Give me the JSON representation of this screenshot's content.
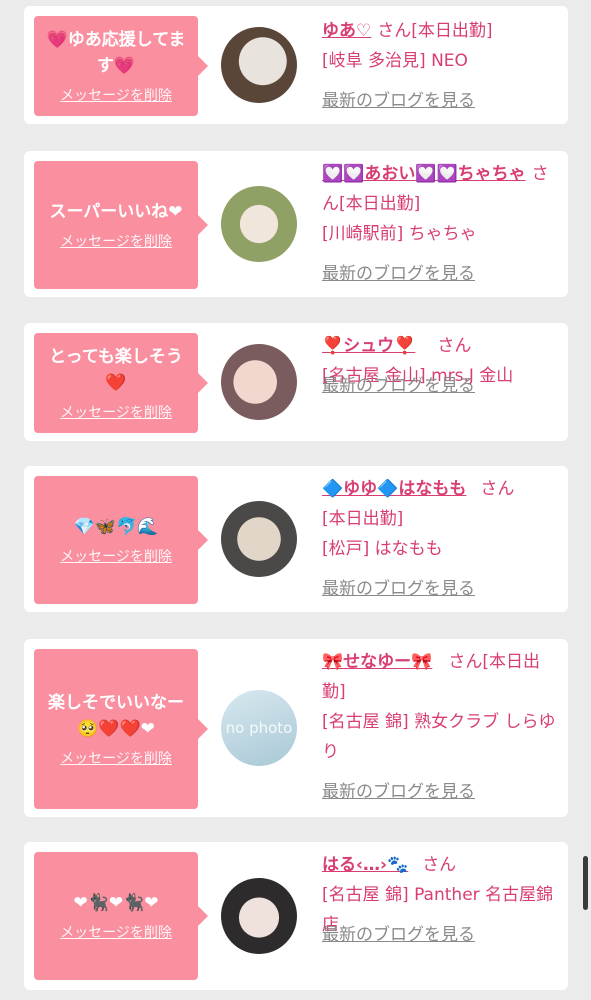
{
  "entries": [
    {
      "message": "💗ゆあ応援してます💗",
      "delete_label": "メッセージを削除",
      "name": "ゆあ♡",
      "suffix": "さん",
      "line1": "[本日出勤]",
      "line2": "[岐阜 多治見] NEO",
      "blog_label": "最新のブログを見る",
      "avatar_colors": [
        "#d9d4cf",
        "#3b2d25"
      ]
    },
    {
      "message": "スーパーいいね❤",
      "delete_label": "メッセージを削除",
      "name": "💟💟あおい💟💟ちゃちゃ",
      "suffix": "さん",
      "line1": "[本日出勤]",
      "line2": "[川崎駅前] ちゃちゃ",
      "blog_label": "最新のブログを見る",
      "avatar_colors": [
        "#a8b47a",
        "#e7ddd0"
      ]
    },
    {
      "message": "とっても楽しそう❤️",
      "delete_label": "メッセージを削除",
      "name": "❣️シュウ❣️",
      "suffix": "さん",
      "line1": "[名古屋 金山] mrs.J 金山",
      "line2": "",
      "blog_label": "最新のブログを見る",
      "avatar_colors": [
        "#8d6d6f",
        "#e9c9c4"
      ]
    },
    {
      "message": "💎🦋🐬🌊",
      "delete_label": "メッセージを削除",
      "name": "🔷ゆゆ🔷はなもも",
      "suffix": "さん",
      "line1": "[本日出勤]",
      "line2": "[松戸] はなもも",
      "blog_label": "最新のブログを見る",
      "avatar_colors": [
        "#5c5a58",
        "#d9d0c4"
      ]
    },
    {
      "message": "楽しそでいいなー🥺❤️❤️❤",
      "delete_label": "メッセージを削除",
      "name": "🎀せなゆー🎀",
      "suffix": "さん",
      "line1": "[本日出勤]",
      "line2": "[名古屋 錦] 熟女クラブ しらゆり",
      "blog_label": "最新のブログを見る",
      "avatar_text": "no photo",
      "avatar_colors": [
        "#bcd7e2",
        "#dbe9ef"
      ]
    },
    {
      "message": "❤🐈‍⬛❤🐈‍⬛❤",
      "delete_label": "メッセージを削除",
      "name": "はる‹…›🐾",
      "suffix": "さん",
      "line1": "[名古屋 錦] Panther 名古屋錦店",
      "line2": "",
      "blog_label": "最新のブログを見る",
      "avatar_colors": [
        "#2c2a2b",
        "#e8d9d3"
      ]
    }
  ],
  "colors": {
    "bubble": "#fa8fa0",
    "name": "#d83d74",
    "muted": "#8a8a8a",
    "background": "#ebebeb"
  }
}
